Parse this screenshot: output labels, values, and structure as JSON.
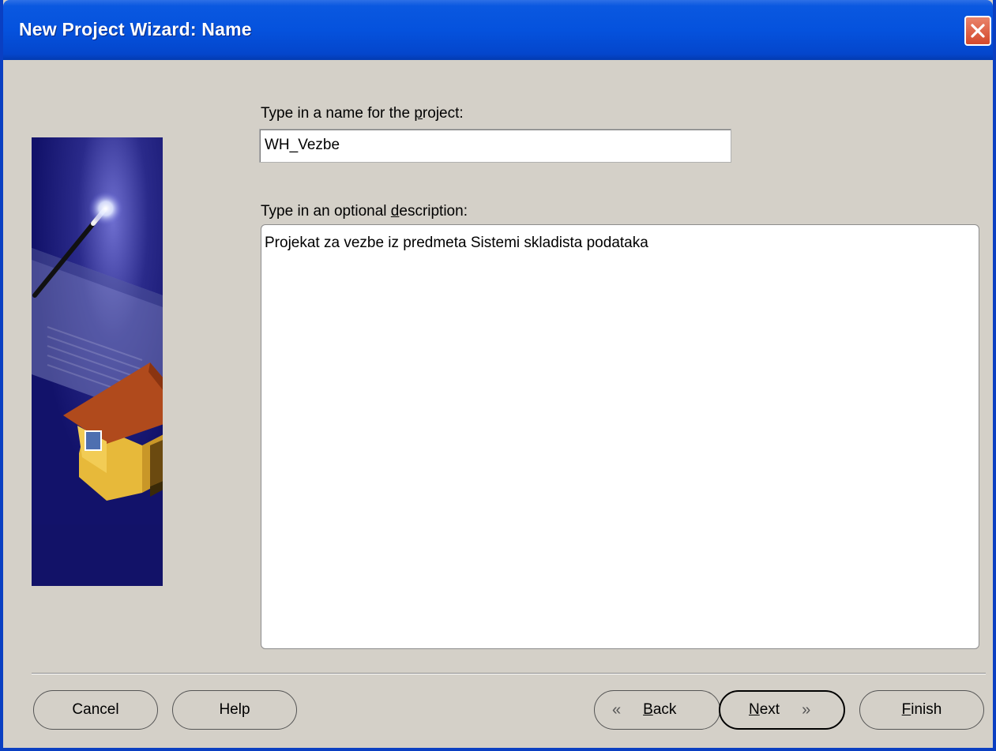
{
  "window": {
    "title": "New Project Wizard: Name"
  },
  "form": {
    "name_label_pre": "Type in a name for the ",
    "name_label_mnemonic": "p",
    "name_label_post": "roject:",
    "name_value": "WH_Vezbe",
    "desc_label_pre": "Type in an optional ",
    "desc_label_mnemonic": "d",
    "desc_label_post": "escription:",
    "desc_value": "Projekat za vezbe iz predmeta Sistemi skladista podataka"
  },
  "buttons": {
    "cancel": "Cancel",
    "help": "Help",
    "back_mnemonic": "B",
    "back_rest": "ack",
    "next_mnemonic": "N",
    "next_rest": "ext",
    "finish_mnemonic": "F",
    "finish_rest": "inish"
  },
  "icons": {
    "close": "close-icon",
    "back": "chevron-left-icon",
    "next": "chevron-right-icon",
    "wizard_art": "wizard-house-icon"
  },
  "colors": {
    "titlebar": "#0552dd",
    "dialog_bg": "#d4d0c8",
    "art_bg": "#1e1e78"
  }
}
